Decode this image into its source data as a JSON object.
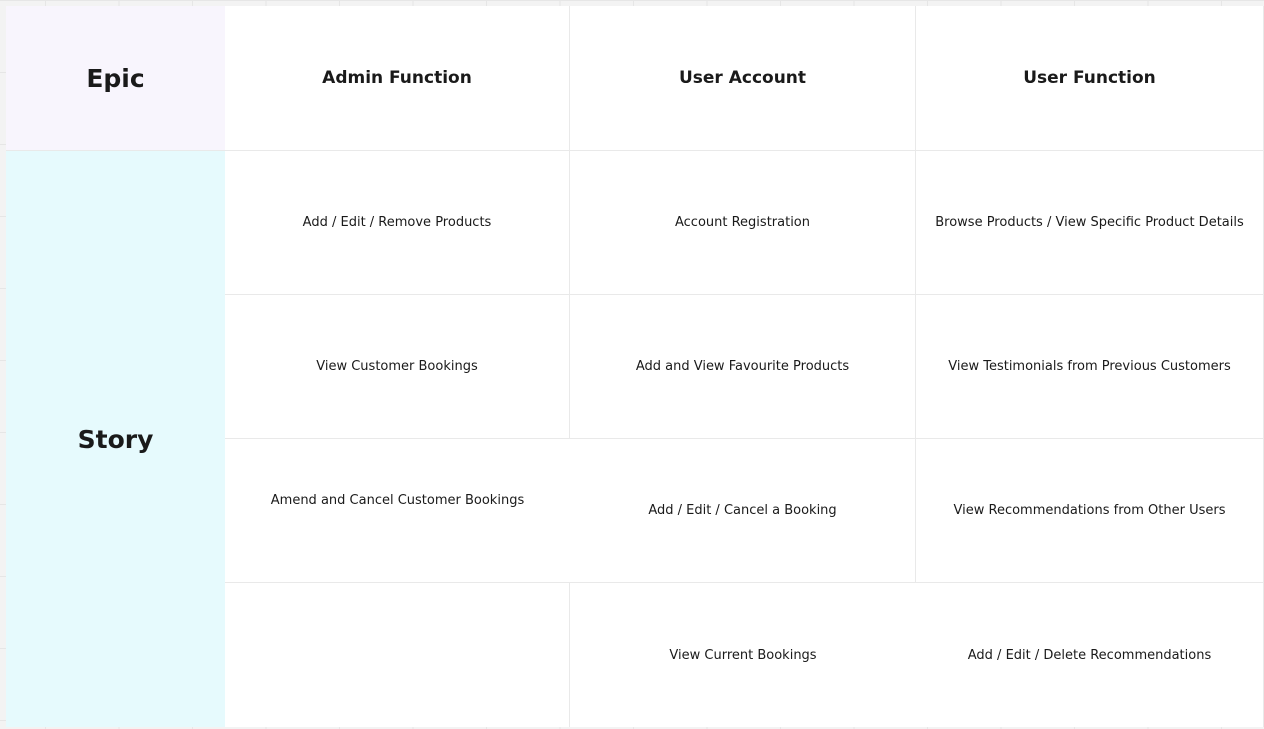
{
  "board": {
    "epic_label": "Epic",
    "story_label": "Story",
    "columns": [
      "Admin Function",
      "User Account",
      "User Function"
    ],
    "rows": [
      [
        "Add / Edit / Remove Products",
        "Account Registration",
        "Browse Products / View Specific Product Details"
      ],
      [
        "View Customer Bookings",
        "Add and View Favourite Products",
        "View Testimonials from Previous Customers"
      ],
      [
        "Amend and Cancel Customer Bookings",
        "Add / Edit / Cancel a Booking",
        "View Recommendations from Other Users"
      ],
      [
        "",
        "View Current Bookings",
        "Add / Edit / Delete Recommendations"
      ]
    ]
  },
  "colors": {
    "epic_bg": "#f8f5fd",
    "story_bg": "#e6fafd",
    "board_bg": "#ffffff",
    "grid_line": "#e9e9e9"
  }
}
